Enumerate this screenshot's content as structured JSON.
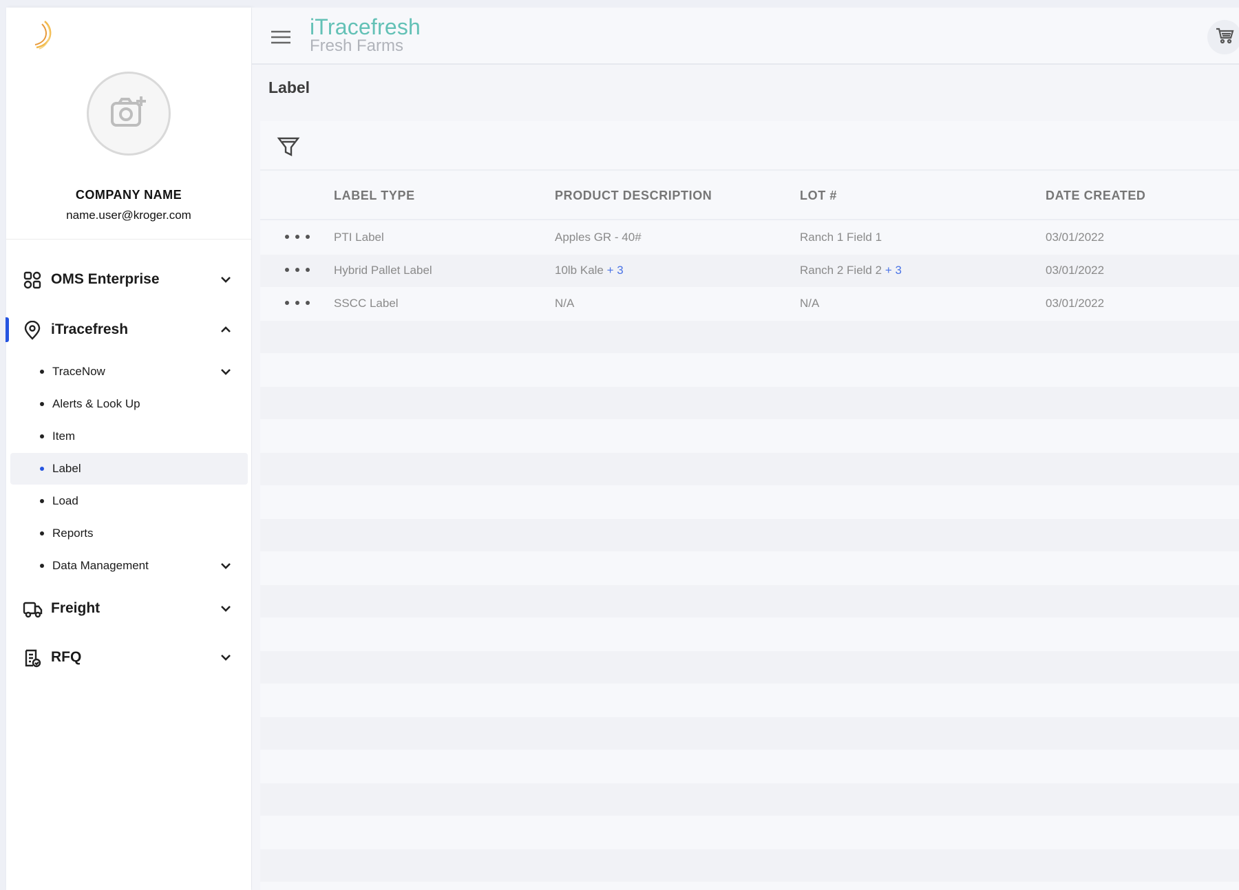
{
  "sidebar": {
    "company_name": "COMPANY NAME",
    "email": "name.user@kroger.com",
    "sections": [
      {
        "label": "OMS Enterprise",
        "icon": "grid-icon",
        "expanded": false
      },
      {
        "label": "iTracefresh",
        "icon": "location-pin-icon",
        "expanded": true
      },
      {
        "label": "Freight",
        "icon": "truck-icon",
        "expanded": false
      },
      {
        "label": "RFQ",
        "icon": "document-check-icon",
        "expanded": false
      }
    ],
    "sub_items": [
      {
        "label": "TraceNow",
        "has_chevron": true
      },
      {
        "label": "Alerts & Look Up",
        "has_chevron": false
      },
      {
        "label": "Item",
        "has_chevron": false
      },
      {
        "label": "Label",
        "has_chevron": false,
        "active": true
      },
      {
        "label": "Load",
        "has_chevron": false
      },
      {
        "label": "Reports",
        "has_chevron": false
      },
      {
        "label": "Data Management",
        "has_chevron": true
      }
    ]
  },
  "header": {
    "brand_name": "iTracefresh",
    "brand_sub": "Fresh Farms"
  },
  "page": {
    "title": "Label"
  },
  "table": {
    "columns": [
      "LABEL TYPE",
      "PRODUCT DESCRIPTION",
      "LOT #",
      "DATE CREATED"
    ],
    "rows": [
      {
        "label_type": "PTI Label",
        "product": "Apples GR - 40#",
        "product_more": "",
        "lot": "Ranch 1 Field 1",
        "lot_more": "",
        "date": "03/01/2022"
      },
      {
        "label_type": "Hybrid Pallet Label",
        "product": "10lb Kale",
        "product_more": "+ 3",
        "lot": "Ranch 2 Field 2",
        "lot_more": "+ 3",
        "date": "03/01/2022"
      },
      {
        "label_type": "SSCC Label",
        "product": "N/A",
        "product_more": "",
        "lot": "N/A",
        "lot_more": "",
        "date": "03/01/2022"
      }
    ]
  },
  "colors": {
    "accent": "#2554e0",
    "brand": "#63c1b6",
    "link": "#4b74e6"
  }
}
